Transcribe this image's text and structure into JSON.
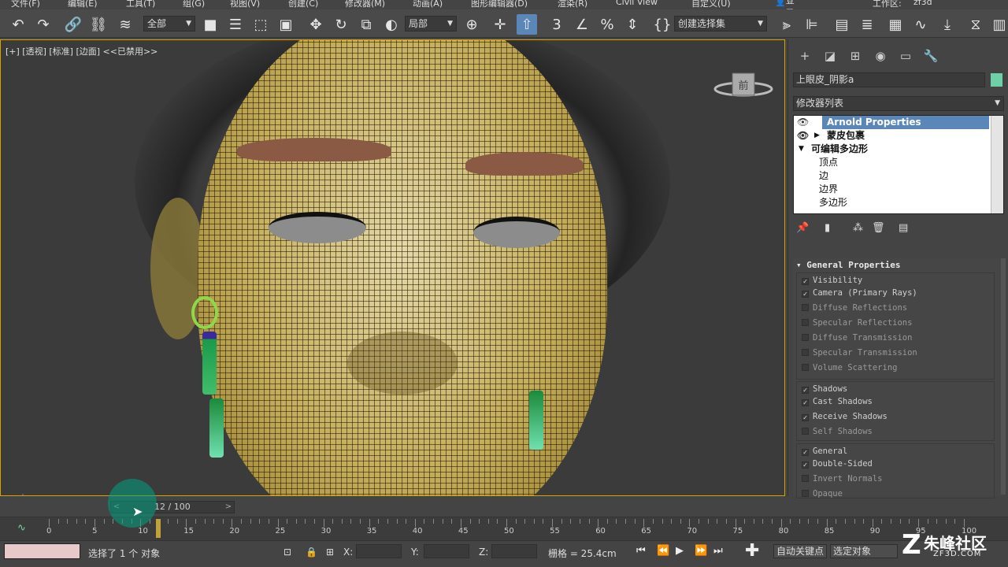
{
  "menu": [
    "文件(F)",
    "编辑(E)",
    "工具(T)",
    "组(G)",
    "视图(V)",
    "创建(C)",
    "修改器(M)",
    "动画(A)",
    "图形编辑器(D)",
    "渲染(R)",
    "Civil View",
    "自定义(U)"
  ],
  "signin": "登录",
  "workspace_label": "工作区:",
  "workspace_value": "zf3d",
  "toolbar": {
    "selection_filter": "全部",
    "ref_coord": "局部",
    "named_selection": "创建选择集"
  },
  "viewport": {
    "label": "[+] [透视] [标准] [边面] <<已禁用>>",
    "viewcube_face": "前"
  },
  "command_panel": {
    "object_name": "上眼皮_阴影a",
    "object_color": "#6fd0a8",
    "modifier_list": "修改器列表",
    "stack": [
      {
        "label": "Arnold Properties",
        "selected": true
      },
      {
        "label": "蒙皮包裹",
        "selected": false
      },
      {
        "label": "可编辑多边形",
        "selected": false
      },
      {
        "label": "顶点",
        "selected": false
      },
      {
        "label": "边",
        "selected": false
      },
      {
        "label": "边界",
        "selected": false
      },
      {
        "label": "多边形",
        "selected": false
      }
    ],
    "rollout_title": "General Properties",
    "group_visibility": [
      {
        "label": "Visibility",
        "checked": true
      },
      {
        "label": "Camera (Primary Rays)",
        "checked": true
      },
      {
        "label": "Diffuse Reflections",
        "checked": false
      },
      {
        "label": "Specular Reflections",
        "checked": false
      },
      {
        "label": "Diffuse Transmission",
        "checked": false
      },
      {
        "label": "Specular Transmission",
        "checked": false
      },
      {
        "label": "Volume Scattering",
        "checked": false
      }
    ],
    "group_shadows": [
      {
        "label": "Shadows",
        "checked": true
      },
      {
        "label": "Cast Shadows",
        "checked": true
      },
      {
        "label": "Receive Shadows",
        "checked": true
      },
      {
        "label": "Self Shadows",
        "checked": false
      }
    ],
    "group_general": [
      {
        "label": "General",
        "checked": true
      },
      {
        "label": "Double-Sided",
        "checked": true
      },
      {
        "label": "Invert Normals",
        "checked": false
      },
      {
        "label": "Opaque",
        "checked": false
      }
    ]
  },
  "time_slider": {
    "value": "12 / 100",
    "prev": "<",
    "next": ">"
  },
  "timeline": {
    "ticks": [
      0,
      5,
      10,
      15,
      20,
      25,
      30,
      35,
      40,
      45,
      50,
      55,
      60,
      65,
      70,
      75,
      80,
      85,
      90,
      95,
      100
    ],
    "current_frame": 12
  },
  "status": {
    "selection_text": "选择了 1 个 对象",
    "x_label": "X:",
    "y_label": "Y:",
    "z_label": "Z:",
    "grid": "栅格 = 25.4cm",
    "auto_key": "自动关键点",
    "selected_object": "选定对象"
  },
  "watermark": {
    "brand": "朱峰社区",
    "domain": "ZF3D.COM",
    "logo_letter": "Z"
  }
}
